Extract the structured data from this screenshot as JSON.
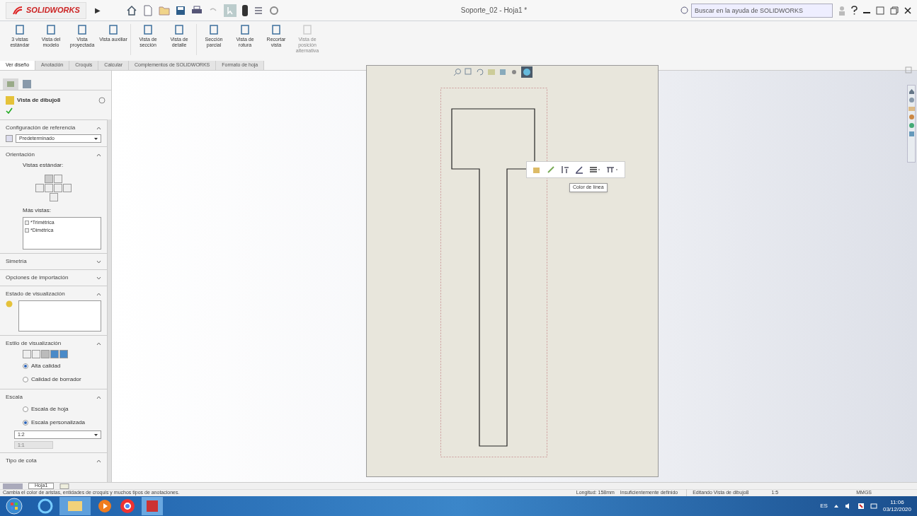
{
  "title_bar": {
    "logo": "SOLIDWORKS",
    "expand_arrow": "▶",
    "document_title": "Soporte_02 - Hoja1 *",
    "search": {
      "placeholder": "Buscar en la ayuda de SOLIDWORKS"
    }
  },
  "ribbon": [
    {
      "label": "3 vistas estándar",
      "disabled": false
    },
    {
      "label": "Vista del modelo",
      "disabled": false
    },
    {
      "label": "Vista proyectada",
      "disabled": false
    },
    {
      "label": "Vista auxiliar",
      "disabled": false
    },
    {
      "label": "Vista de sección",
      "disabled": false
    },
    {
      "label": "Vista de detalle",
      "disabled": false
    },
    {
      "label": "Sección parcial",
      "disabled": false
    },
    {
      "label": "Vista de rotura",
      "disabled": false
    },
    {
      "label": "Recortar vista",
      "disabled": false
    },
    {
      "label": "Vista de posición alternativa",
      "disabled": true
    }
  ],
  "tabs": [
    {
      "label": "Ver diseño",
      "selected": true
    },
    {
      "label": "Anotación",
      "selected": false
    },
    {
      "label": "Croquis",
      "selected": false
    },
    {
      "label": "Calcular",
      "selected": false
    },
    {
      "label": "Complementos de SOLIDWORKS",
      "selected": false
    },
    {
      "label": "Formato de hoja",
      "selected": false
    }
  ],
  "property_manager": {
    "title": "Vista de dibujo8",
    "sections": [
      {
        "kind": "dropdown",
        "title": "Configuración de referencia",
        "expanded": true,
        "value": "Predeterminado"
      },
      {
        "kind": "orientation",
        "title": "Orientación",
        "expanded": true,
        "label": "Vistas estándar:",
        "more_label": "Más vistas:",
        "views": [
          {
            "label": "*Trimétrica",
            "checked": false
          },
          {
            "label": "*Dimétrica",
            "checked": false
          }
        ]
      },
      {
        "kind": "header",
        "title": "Simetría",
        "expanded": false
      },
      {
        "kind": "header",
        "title": "Opciones de importación",
        "expanded": false
      },
      {
        "kind": "states",
        "title": "Estado de visualización",
        "expanded": true
      },
      {
        "kind": "radios",
        "title": "Estilo de visualización",
        "expanded": true,
        "options": [
          {
            "label": "Alta calidad",
            "selected": true
          },
          {
            "label": "Calidad de borrador",
            "selected": false
          }
        ]
      },
      {
        "kind": "scale",
        "title": "Escala",
        "expanded": true,
        "options": [
          {
            "label": "Escala de hoja",
            "selected": false
          },
          {
            "label": "Escala personalizada",
            "selected": true
          }
        ],
        "value": "1:2",
        "custom": "1:1"
      },
      {
        "kind": "header",
        "title": "Tipo de cota",
        "expanded": true
      }
    ]
  },
  "sheet_tabs": [
    {
      "label": "Hoja1",
      "selected": true
    }
  ],
  "context_toolbar": {
    "tooltip": "Color de línea"
  },
  "status_bar": {
    "message": "Cambia el color de aristas, entidades de croquis y muchos tipos de anotaciones.",
    "length": "Longitud: 158mm",
    "definition": "Insuficientemente definido",
    "editing": "Editando Vista de dibujo8",
    "scale": "1:5",
    "units": "MMGS"
  },
  "taskbar": {
    "language": "ES",
    "time": "11:06",
    "date": "03/12/2020"
  }
}
